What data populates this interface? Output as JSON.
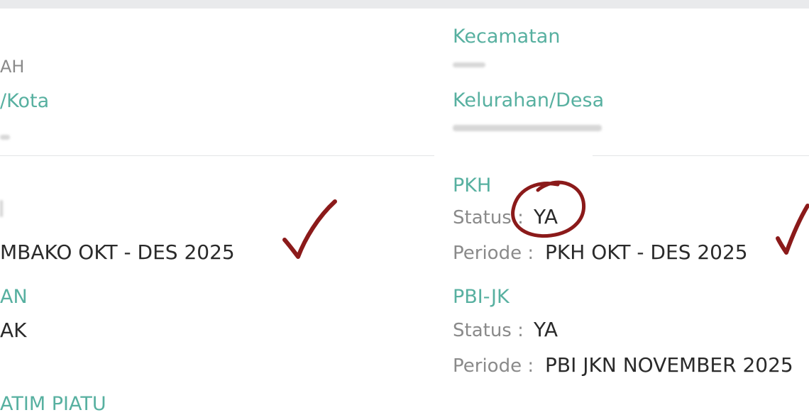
{
  "left": {
    "province_value_fragment": "AH",
    "city_label_fragment": "/Kota",
    "sembako_period_fragment": "MBAKO OKT - DES 2025",
    "bpnt_label_fragment": "AN",
    "bpnt_value_fragment": "AK",
    "yatim_label_fragment": "ATIM PIATU"
  },
  "right": {
    "district_label": "Kecamatan",
    "village_label": "Kelurahan/Desa",
    "pkh": {
      "label": "PKH",
      "status_key": "Status :",
      "status_value": "YA",
      "period_key": "Periode :",
      "period_value": "PKH OKT - DES 2025"
    },
    "pbi": {
      "label": "PBI-JK",
      "status_key": "Status :",
      "status_value": "YA",
      "period_key": "Periode :",
      "period_value": "PBI JKN NOVEMBER 2025"
    }
  },
  "annotations": {
    "ink_color": "#8b1a1a",
    "checkmark_icon_count": 2,
    "circle_around": "YA"
  }
}
